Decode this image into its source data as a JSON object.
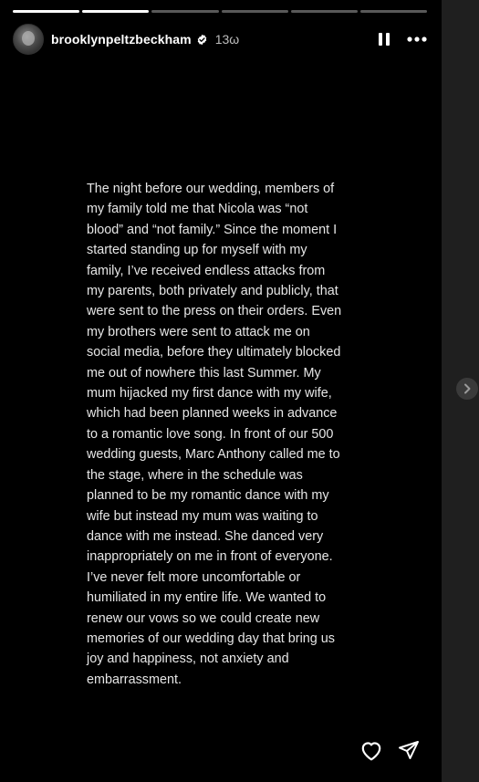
{
  "story": {
    "username": "brooklynpeltzbeckham",
    "time": "13ω",
    "progress": [
      1.0,
      1.0,
      0.0,
      0.0,
      0.0,
      0.0
    ],
    "text_lines": [
      "The night before our wedding, members of",
      "my family told me that Nicola was “not",
      "blood” and “not family.” Since the moment I",
      "started standing up for myself with my",
      "family, I’ve received endless attacks from",
      "my parents, both privately and publicly, that",
      "were sent to the press on their orders. Even",
      "my brothers were sent to attack me on",
      "social media, before they ultimately blocked",
      "me out of nowhere this last Summer. My",
      "mum hijacked my first dance with my wife,",
      "which had been planned weeks in advance",
      "to a romantic love song. In front of our 500",
      "wedding guests, Marc Anthony called me to",
      "the stage, where in the schedule was",
      "planned to be my romantic dance with my",
      "wife but instead my mum was waiting to",
      "dance with me instead. She danced very",
      "inappropriately on me in front of everyone.",
      "I’ve never felt more uncomfortable or",
      "humiliated in my entire life. We wanted to",
      "renew our vows so we could create new",
      "memories of our wedding day that bring us",
      "joy and happiness, not anxiety and",
      "embarrassment."
    ]
  },
  "icons": {
    "pause": "pause-icon",
    "more": "more-icon",
    "like": "heart-icon",
    "share": "send-icon",
    "next": "chevron-right-icon",
    "verified": "verified-badge-icon"
  },
  "colors": {
    "background": "#000000",
    "page": "#1f1f1f",
    "text": "#e6e6e6",
    "verified": "#ffffff"
  }
}
